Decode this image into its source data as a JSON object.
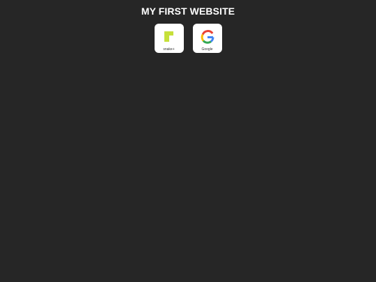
{
  "page": {
    "title": "MY FIRST WEBSITE"
  },
  "shortcuts": [
    {
      "label": "snake+",
      "icon": "snake-plus-icon"
    },
    {
      "label": "Google",
      "icon": "google-icon"
    }
  ],
  "colors": {
    "background": "#262626",
    "title_text": "#ffffff",
    "tile_background": "#ffffff",
    "snake_icon": "#c6e03a",
    "google_blue": "#4285F4",
    "google_red": "#EA4335",
    "google_yellow": "#FBBC05",
    "google_green": "#34A853"
  }
}
